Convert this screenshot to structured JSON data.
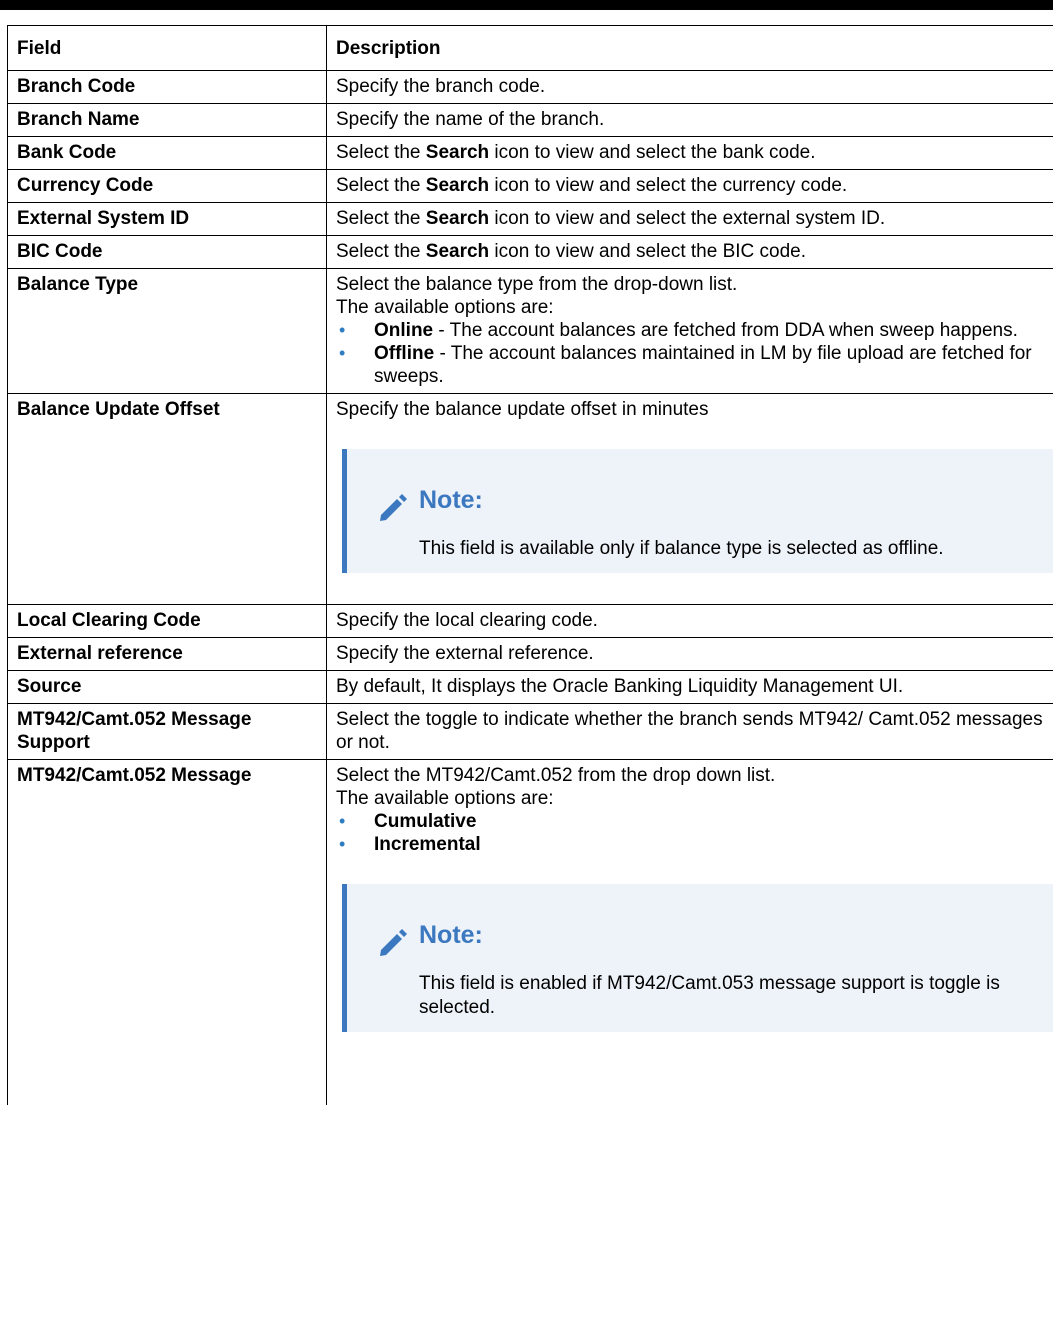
{
  "table": {
    "headers": {
      "field": "Field",
      "description": "Description"
    },
    "rows": [
      {
        "field": "Branch Code",
        "desc": "Specify the branch code."
      },
      {
        "field": "Branch Name",
        "desc": "Specify the name of the branch."
      },
      {
        "field": "Bank Code",
        "desc_pre": "Select the ",
        "desc_bold": "Search",
        "desc_post": " icon to view and select the bank code."
      },
      {
        "field": "Currency Code",
        "desc_pre": "Select the ",
        "desc_bold": "Search",
        "desc_post": " icon to view and select the currency code."
      },
      {
        "field": "External System ID",
        "desc_pre": "Select the ",
        "desc_bold": "Search",
        "desc_post": " icon to view and select the external system ID."
      },
      {
        "field": "BIC Code",
        "desc_pre": "Select the ",
        "desc_bold": "Search",
        "desc_post": " icon to view and select the BIC code."
      },
      {
        "field": "Balance Type",
        "line1": "Select the balance type from the drop-down list.",
        "line2": "The available options are:",
        "options": [
          {
            "bold": "Online",
            "text": " - The account balances are fetched from DDA when sweep happens."
          },
          {
            "bold": "Offline",
            "text": " - The account balances maintained in LM by file upload are fetched for sweeps."
          }
        ]
      },
      {
        "field": "Balance Update Offset",
        "desc": "Specify the balance update offset in minutes",
        "note_title": "Note:",
        "note_body": "This field is available only if balance type is selected as offline."
      },
      {
        "field": "Local Clearing Code",
        "desc": "Specify the local clearing code."
      },
      {
        "field": "External reference",
        "desc": "Specify the external reference."
      },
      {
        "field": "Source",
        "desc": "By default, It displays the Oracle Banking Liquidity Management UI."
      },
      {
        "field": "MT942/Camt.052 Message Support",
        "desc": "Select the toggle to indicate whether the branch sends MT942/ Camt.052 messages or not."
      },
      {
        "field": "MT942/Camt.052 Message",
        "line1": "Select the MT942/Camt.052 from the drop down list.",
        "line2": "The available options are:",
        "options": [
          {
            "bold": "Cumulative"
          },
          {
            "bold": "Incremental"
          }
        ],
        "note_title": "Note:",
        "note_body": "This field is enabled if MT942/Camt.053 message support is toggle is selected."
      }
    ]
  },
  "icons": {
    "bullet": "•",
    "note_icon": "pencil-icon"
  },
  "colors": {
    "note_accent": "#3b78c0",
    "note_background": "#eef3f9",
    "bullet": "#2e7cc1"
  }
}
